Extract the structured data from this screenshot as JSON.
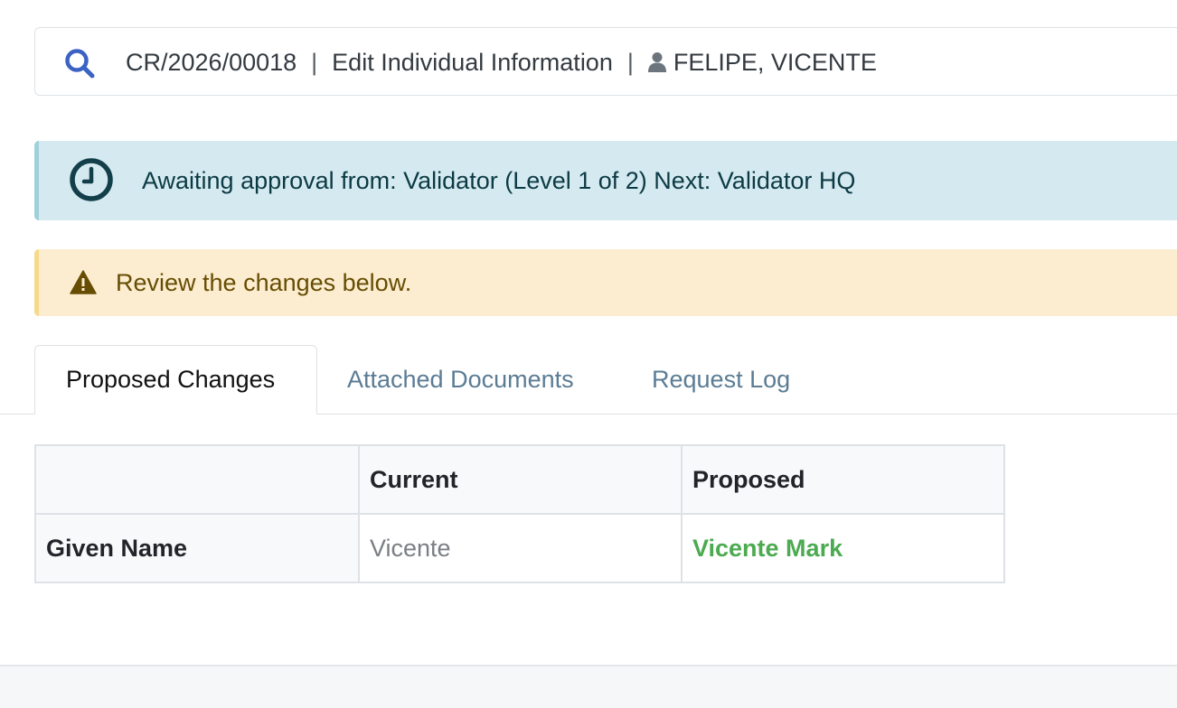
{
  "header": {
    "reference": "CR/2026/00018",
    "separator": "|",
    "action": "Edit Individual Information",
    "person_name": "FELIPE, VICENTE",
    "search_icon": "search-icon",
    "person_icon": "user-icon"
  },
  "alerts": {
    "info": {
      "icon": "clock-icon",
      "text": "Awaiting approval from: Validator (Level 1 of 2) Next: Validator HQ"
    },
    "warning": {
      "icon": "warning-icon",
      "text": "Review the changes below."
    }
  },
  "tabs": [
    {
      "label": "Proposed Changes",
      "active": true
    },
    {
      "label": "Attached Documents",
      "active": false
    },
    {
      "label": "Request Log",
      "active": false
    }
  ],
  "table": {
    "headers": [
      "",
      "Current",
      "Proposed"
    ],
    "rows": [
      {
        "field": "Given Name",
        "current": "Vicente",
        "proposed": "Vicente Mark"
      }
    ]
  },
  "colors": {
    "info_bg": "#d4eaf0",
    "warning_bg": "#fcedd0",
    "proposed_text": "#4caa50",
    "search_icon": "#3b63c4",
    "tab_inactive": "#5b7c94"
  }
}
